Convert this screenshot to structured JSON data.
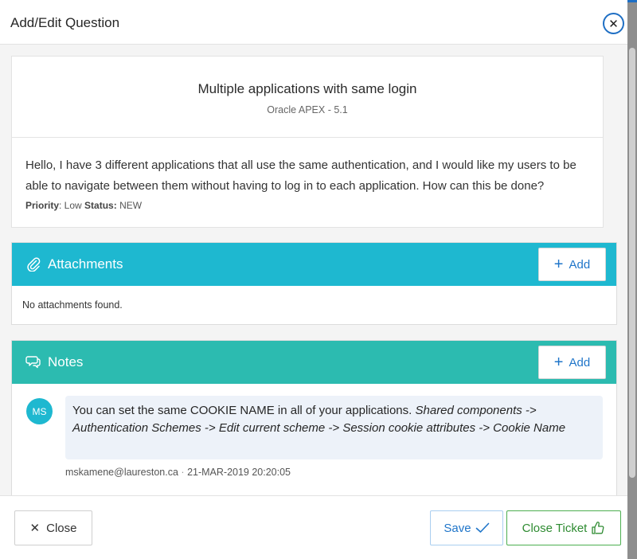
{
  "dialog": {
    "title": "Add/Edit Question",
    "close_icon": "close-icon"
  },
  "question": {
    "title": "Multiple applications with same login",
    "subtitle": "Oracle APEX - 5.1",
    "text": "Hello, I have 3 different applications that all use the same authentication, and I would like my users to be able to navigate between them without having to log in to each application. How can this be done?",
    "priority_label": "Priority",
    "priority_value": ": Low",
    "status_label": "Status:",
    "status_value": "NEW"
  },
  "attachments": {
    "title": "Attachments",
    "icon": "paperclip-icon",
    "add_label": "Add",
    "empty_text": "No attachments found."
  },
  "notes": {
    "title": "Notes",
    "icon": "comments-icon",
    "add_label": "Add",
    "items": [
      {
        "avatar": "MS",
        "text_plain": "You can set the same COOKIE NAME in all of your applications. ",
        "text_italic": "Shared components -> Authentication Schemes -> Edit current scheme -> Session cookie attributes -> Cookie Name",
        "author": "mskamene@laureston.ca",
        "separator": "·",
        "timestamp": "21-MAR-2019 20:20:05"
      }
    ]
  },
  "footer": {
    "close_label": "Close",
    "save_label": "Save",
    "close_ticket_label": "Close Ticket"
  },
  "colors": {
    "attachments_header": "#1eb8d0",
    "notes_header": "#2cbbb0",
    "primary_blue": "#1f75c9",
    "success_green": "#2e8b31"
  }
}
